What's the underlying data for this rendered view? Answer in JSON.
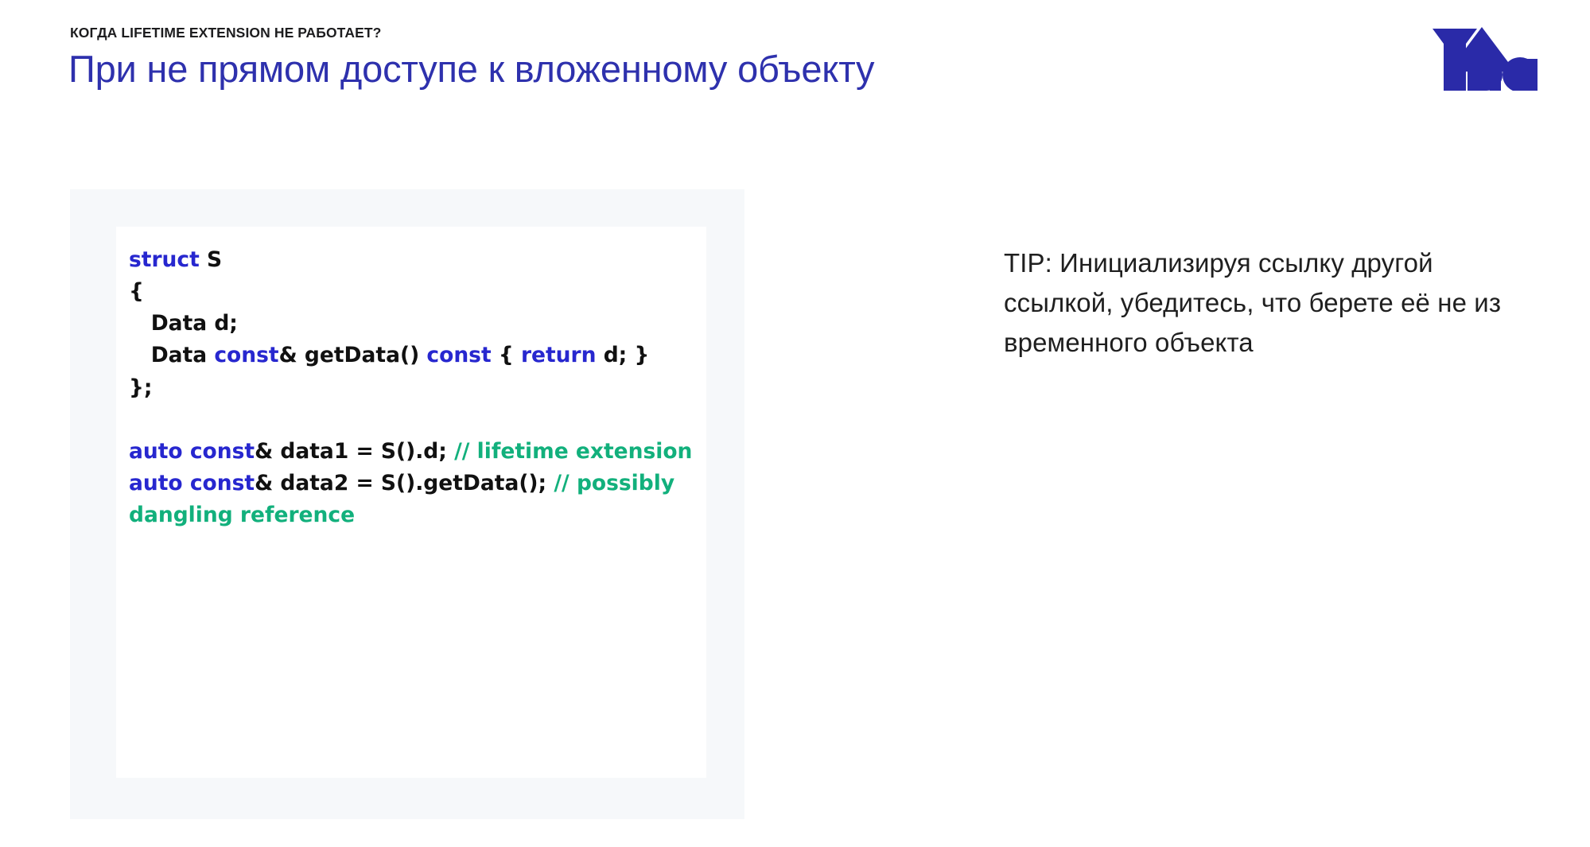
{
  "header": {
    "eyebrow_prefix": "КОГДА ",
    "eyebrow_emphasis": "LIFETIME EXTENSION",
    "eyebrow_suffix": " НЕ РАБОТАЕТ?",
    "eyebrow_full": "КОГДА LIFETIME EXTENSION НЕ РАБОТАЕТ?",
    "title": "При не прямом доступе к вложенному объекту",
    "title_color": "#2e31ad"
  },
  "logo": {
    "name": "YADRO",
    "color": "#2a2aa8"
  },
  "code": {
    "panel_background": "#f6f8fa",
    "card_background": "#ffffff",
    "keyword_color": "#2727cf",
    "comment_color": "#12b07c",
    "text_color": "#111111",
    "lines": [
      {
        "tokens": [
          {
            "t": "struct",
            "c": "kw"
          },
          {
            "t": " S",
            "c": "plain"
          }
        ]
      },
      {
        "tokens": [
          {
            "t": "{",
            "c": "plain"
          }
        ]
      },
      {
        "tokens": [
          {
            "t": "   Data d;",
            "c": "plain"
          }
        ]
      },
      {
        "tokens": [
          {
            "t": "   Data ",
            "c": "plain"
          },
          {
            "t": "const",
            "c": "kw"
          },
          {
            "t": "& getData() ",
            "c": "plain"
          },
          {
            "t": "const",
            "c": "kw"
          },
          {
            "t": " { ",
            "c": "plain"
          },
          {
            "t": "return",
            "c": "kw"
          },
          {
            "t": " d; }",
            "c": "plain"
          }
        ]
      },
      {
        "tokens": [
          {
            "t": "};",
            "c": "plain"
          }
        ]
      },
      {
        "tokens": [
          {
            "t": "",
            "c": "plain"
          }
        ]
      },
      {
        "tokens": [
          {
            "t": "auto const",
            "c": "kw"
          },
          {
            "t": "& data1 = S().d; ",
            "c": "plain"
          },
          {
            "t": "// lifetime extension",
            "c": "cmt"
          }
        ]
      },
      {
        "tokens": [
          {
            "t": "auto const",
            "c": "kw"
          },
          {
            "t": "& data2 = S().getData(); ",
            "c": "plain"
          },
          {
            "t": "// possibly dangling reference",
            "c": "cmt"
          }
        ]
      }
    ]
  },
  "tip": {
    "text": "TIP: Инициализируя ссылку другой ссылкой, убедитесь, что берете её не из временного объекта"
  }
}
